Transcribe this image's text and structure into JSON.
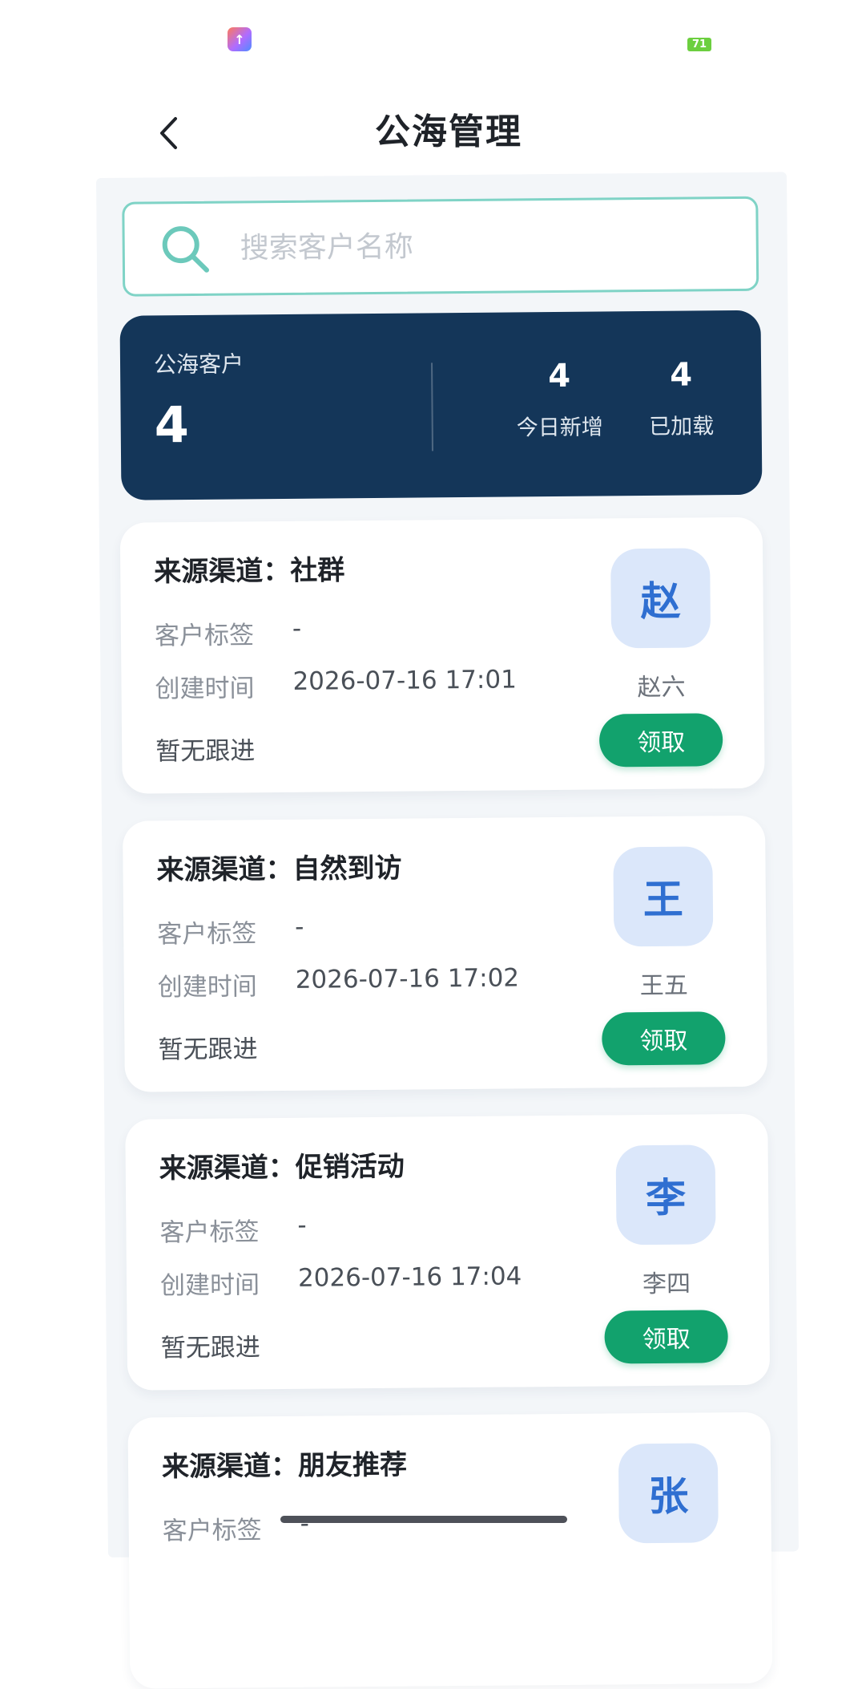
{
  "status_bar": {
    "battery": "71"
  },
  "header": {
    "title": "公海管理"
  },
  "search": {
    "placeholder": "搜索客户名称",
    "value": ""
  },
  "stats": {
    "main_label": "公海客户",
    "main_value": "4",
    "today_new_value": "4",
    "today_new_label": "今日新增",
    "loaded_value": "4",
    "loaded_label": "已加载"
  },
  "customers": [
    {
      "source_label": "来源渠道：社群",
      "tag_key": "客户标签",
      "tag_value": "-",
      "time_key": "创建时间",
      "time_value": "2026-07-16 17:01",
      "follow": "暂无跟进",
      "avatar_char": "赵",
      "name": "赵六",
      "button": "领取"
    },
    {
      "source_label": "来源渠道：自然到访",
      "tag_key": "客户标签",
      "tag_value": "-",
      "time_key": "创建时间",
      "time_value": "2026-07-16 17:02",
      "follow": "暂无跟进",
      "avatar_char": "王",
      "name": "王五",
      "button": "领取"
    },
    {
      "source_label": "来源渠道：促销活动",
      "tag_key": "客户标签",
      "tag_value": "-",
      "time_key": "创建时间",
      "time_value": "2026-07-16 17:04",
      "follow": "暂无跟进",
      "avatar_char": "李",
      "name": "李四",
      "button": "领取"
    },
    {
      "source_label": "来源渠道：朋友推荐",
      "tag_key": "客户标签",
      "tag_value": "-",
      "avatar_char": "张"
    }
  ],
  "colors": {
    "stats_background": "#143659",
    "accent_green": "#12a26d",
    "search_border": "#7fd3c6",
    "avatar_background": "#dbe7fa",
    "avatar_text": "#2f6fd1"
  },
  "icons": {
    "back": "chevron-left-icon",
    "search": "search-icon"
  }
}
